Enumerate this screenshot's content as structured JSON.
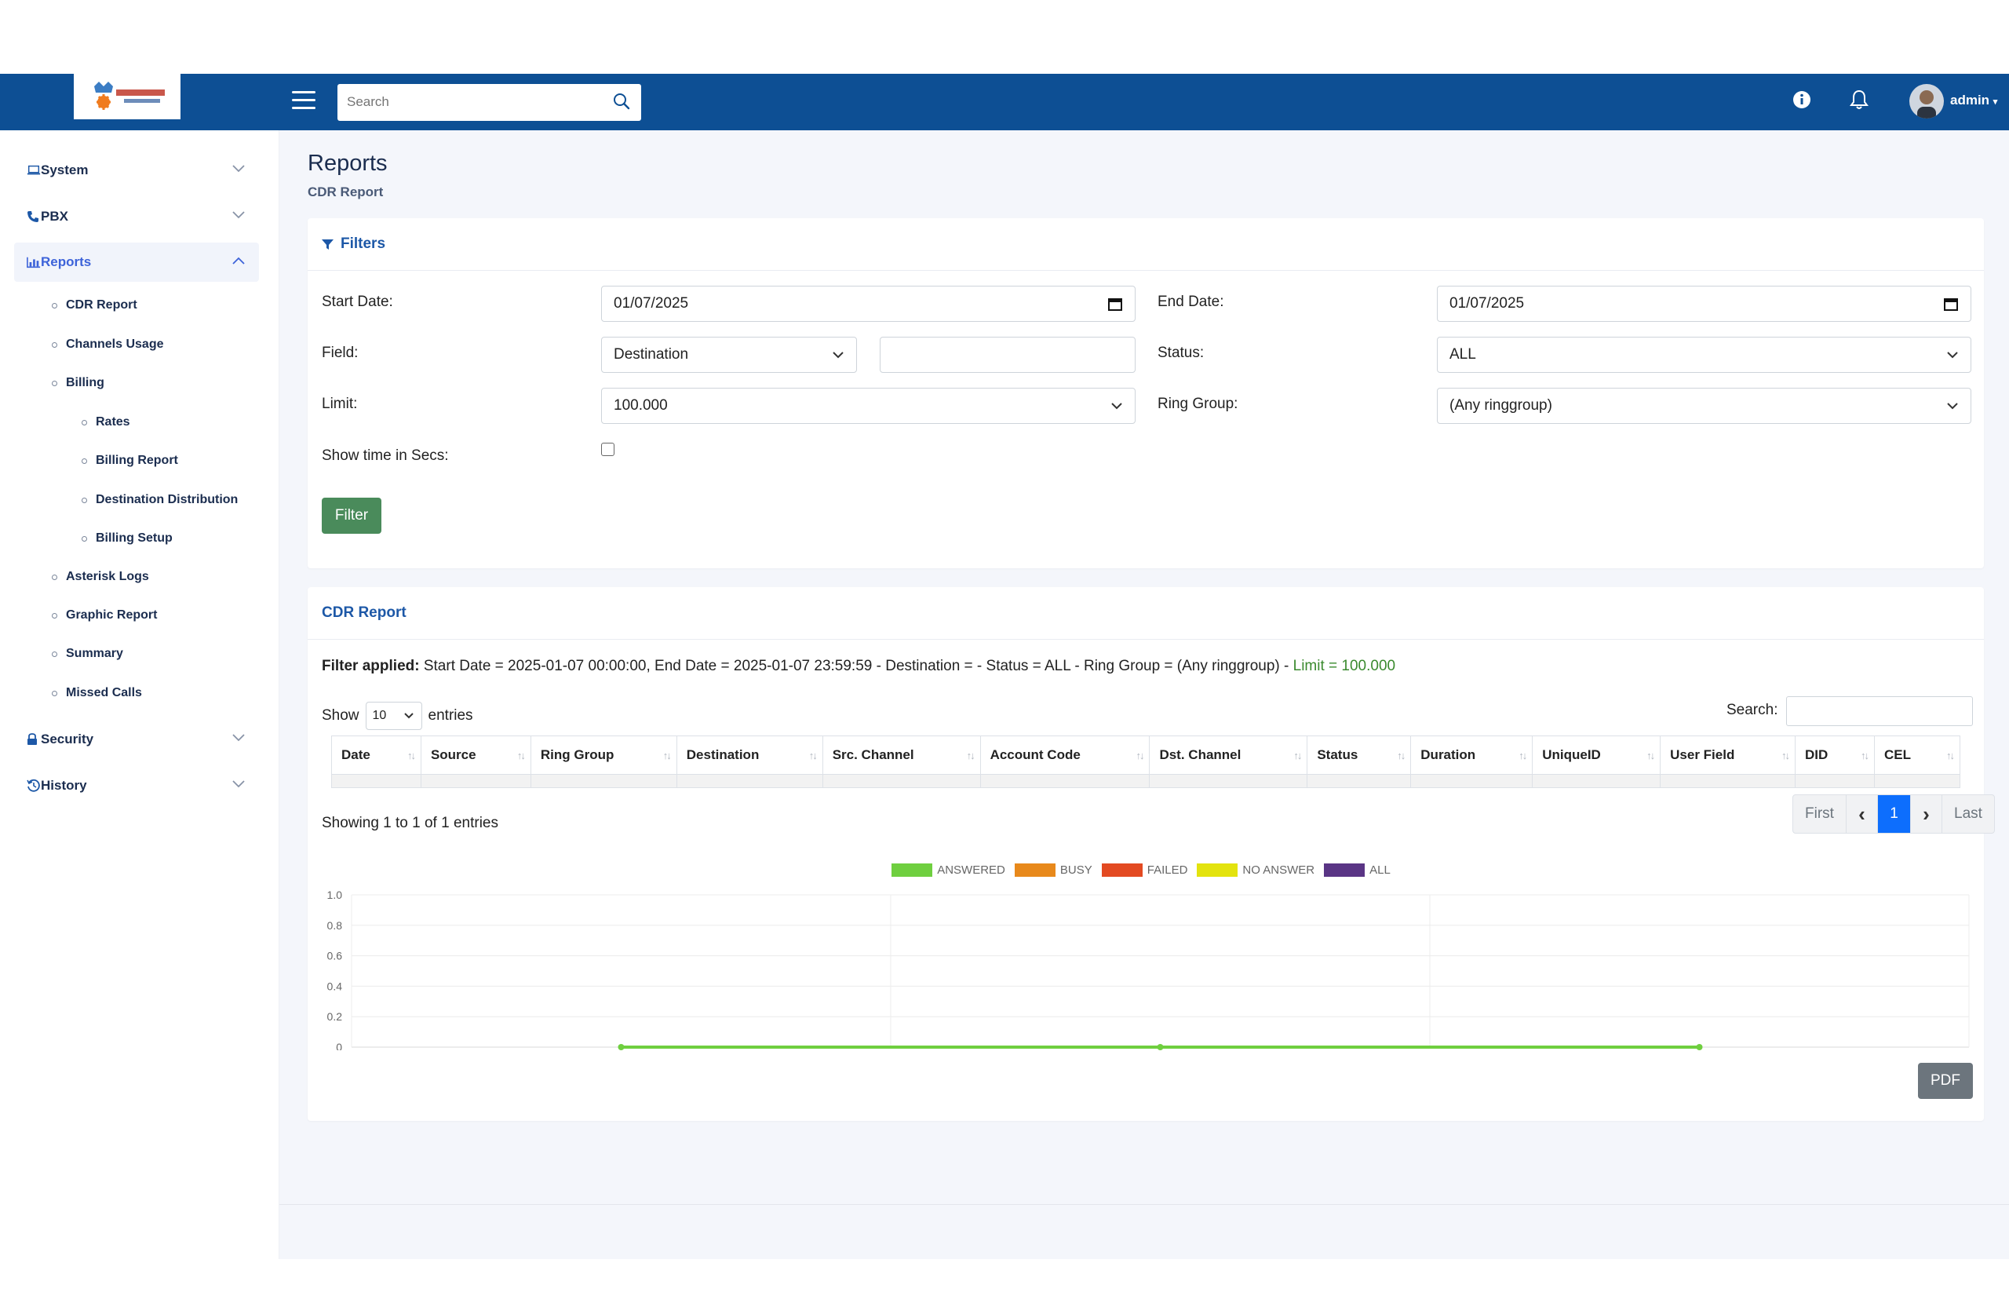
{
  "header": {
    "logo_alt": "KingAsterisk Technologies",
    "search_placeholder": "Search",
    "user": "admin"
  },
  "sidebar": {
    "items": [
      {
        "label": "System",
        "icon": "laptop-icon"
      },
      {
        "label": "PBX",
        "icon": "phone-icon"
      },
      {
        "label": "Reports",
        "icon": "bar-chart-icon"
      },
      {
        "label": "Security",
        "icon": "lock-icon"
      },
      {
        "label": "History",
        "icon": "history-icon"
      }
    ],
    "reports_sub": [
      "CDR Report",
      "Channels Usage",
      "Billing",
      "Asterisk Logs",
      "Graphic Report",
      "Summary",
      "Missed Calls"
    ],
    "billing_sub": [
      "Rates",
      "Billing Report",
      "Destination Distribution",
      "Billing Setup"
    ]
  },
  "page": {
    "title": "Reports",
    "breadcrumb": "CDR Report"
  },
  "filters": {
    "title": "Filters",
    "start_date_label": "Start Date:",
    "start_date": "01/07/2025",
    "end_date_label": "End Date:",
    "end_date": "01/07/2025",
    "field_label": "Field:",
    "field_value": "Destination",
    "field_text": "",
    "status_label": "Status:",
    "status_value": "ALL",
    "limit_label": "Limit:",
    "limit_value": "100.000",
    "ring_group_label": "Ring Group:",
    "ring_group_value": "(Any ringgroup)",
    "show_secs_label": "Show time in Secs:",
    "show_secs_checked": false,
    "button": "Filter"
  },
  "report": {
    "title": "CDR Report",
    "filter_applied_label": "Filter applied:",
    "filter_applied_text": " Start Date = 2025-01-07 00:00:00, End Date = 2025-01-07 23:59:59 - Destination = - Status = ALL - Ring Group = (Any ringgroup) - ",
    "filter_applied_limit": "Limit = 100.000",
    "show_label": "Show",
    "entries_value": "10",
    "entries_label": "entries",
    "search_label": "Search:",
    "columns": [
      "Date",
      "Source",
      "Ring Group",
      "Destination",
      "Src. Channel",
      "Account Code",
      "Dst. Channel",
      "Status",
      "Duration",
      "UniqueID",
      "User Field",
      "DID",
      "CEL"
    ],
    "showing": "Showing 1 to 1 of 1 entries",
    "pager": {
      "first": "First",
      "prev": "‹",
      "current": "1",
      "next": "›",
      "last": "Last"
    },
    "pdf_button": "PDF"
  },
  "colors": {
    "primary": "#0d4f94",
    "answered": "#6fcf3f",
    "busy": "#e8891b",
    "failed": "#e34a22",
    "no_answer": "#e3e30e",
    "all": "#5a3585"
  },
  "chart_data": {
    "type": "line",
    "legend": [
      "ANSWERED",
      "BUSY",
      "FAILED",
      "NO ANSWER",
      "ALL"
    ],
    "ylim": [
      0,
      1.0
    ],
    "yticks": [
      "1.0",
      "0.8",
      "0.6",
      "0.4",
      "0.2",
      "0"
    ],
    "series": [
      {
        "name": "ANSWERED",
        "values": [
          0,
          0,
          0
        ]
      }
    ],
    "grid": true
  }
}
